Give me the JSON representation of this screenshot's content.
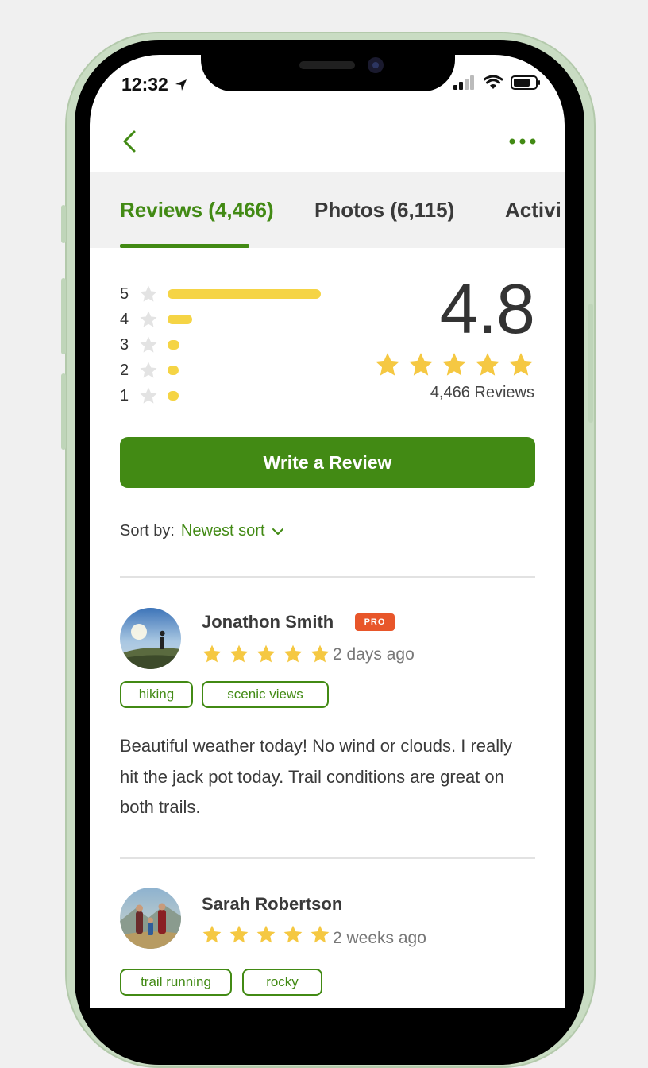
{
  "status_bar": {
    "time": "12:32"
  },
  "tabs": [
    {
      "label": "Reviews (4,466)",
      "active": true
    },
    {
      "label": "Photos (6,115)",
      "active": false
    },
    {
      "label": "Activi",
      "active": false
    }
  ],
  "rating_breakdown": [
    {
      "stars": "5",
      "fraction": 1.0
    },
    {
      "stars": "4",
      "fraction": 0.16
    },
    {
      "stars": "3",
      "fraction": 0.08
    },
    {
      "stars": "2",
      "fraction": 0.07
    },
    {
      "stars": "1",
      "fraction": 0.07
    }
  ],
  "summary": {
    "average": "4.8",
    "star_count": 5,
    "reviews_count_text": "4,466 Reviews"
  },
  "write_review_label": "Write a Review",
  "sort": {
    "label": "Sort by:",
    "value": "Newest sort"
  },
  "reviews": [
    {
      "name": "Jonathon Smith",
      "badge": "PRO",
      "stars": 5,
      "date": "2 days ago",
      "tags": [
        "hiking",
        "scenic views"
      ],
      "text": "Beautiful weather today! No wind or clouds. I really hit the jack pot today. Trail conditions are great on both trails."
    },
    {
      "name": "Sarah Robertson",
      "stars": 5,
      "date": "2 weeks ago",
      "tags": [
        "trail running",
        "rocky"
      ]
    }
  ],
  "colors": {
    "accent_green": "#428a14",
    "star_gold": "#f5c842",
    "bar_yellow": "#f5d445",
    "pro_orange": "#e8562a",
    "tab_bg": "#f1f1f1"
  },
  "icons": [
    "back-chevron-icon",
    "more-dots-icon",
    "star-icon",
    "chevron-down-icon",
    "location-arrow-icon",
    "signal-icon",
    "wifi-icon",
    "battery-icon"
  ]
}
